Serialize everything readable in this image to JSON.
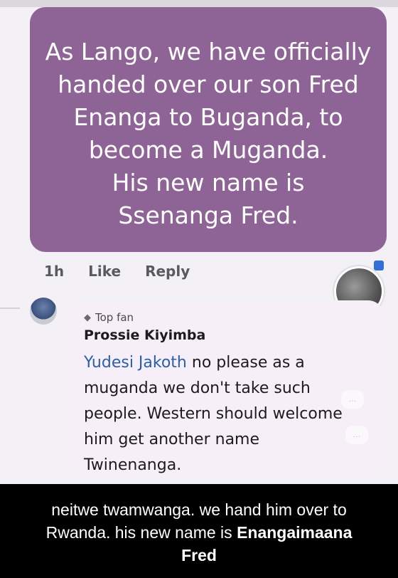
{
  "post": {
    "lines": [
      "As Lango, we have officially",
      "handed over our son Fred",
      "Enanga to Buganda, to",
      "become a Muganda.",
      "His new name is",
      "Ssenanga Fred."
    ],
    "bubble_color": "#8e6497"
  },
  "meta": {
    "time": "1h",
    "like_label": "Like",
    "reply_label": "Reply"
  },
  "story": {
    "plus_label": "+"
  },
  "comment": {
    "badge_icon": "diamond-icon",
    "badge_label": "Top fan",
    "author": "Prossie Kiyimba",
    "mention": "Yudesi Jakoth",
    "lines": [
      " no please as a",
      "muganda we don't take such",
      "people. Western should welcome",
      "him get another name",
      "Twinenanga."
    ],
    "bubble_color": "#f7eff8"
  },
  "caption": {
    "line1": "neitwe twamwanga. we hand him over to",
    "line2_prefix": "Rwanda. his new name is ",
    "line2_bold": "Enangaimaana",
    "line3_bold": "Fred"
  },
  "faint_icons": [
    "...",
    "..."
  ]
}
